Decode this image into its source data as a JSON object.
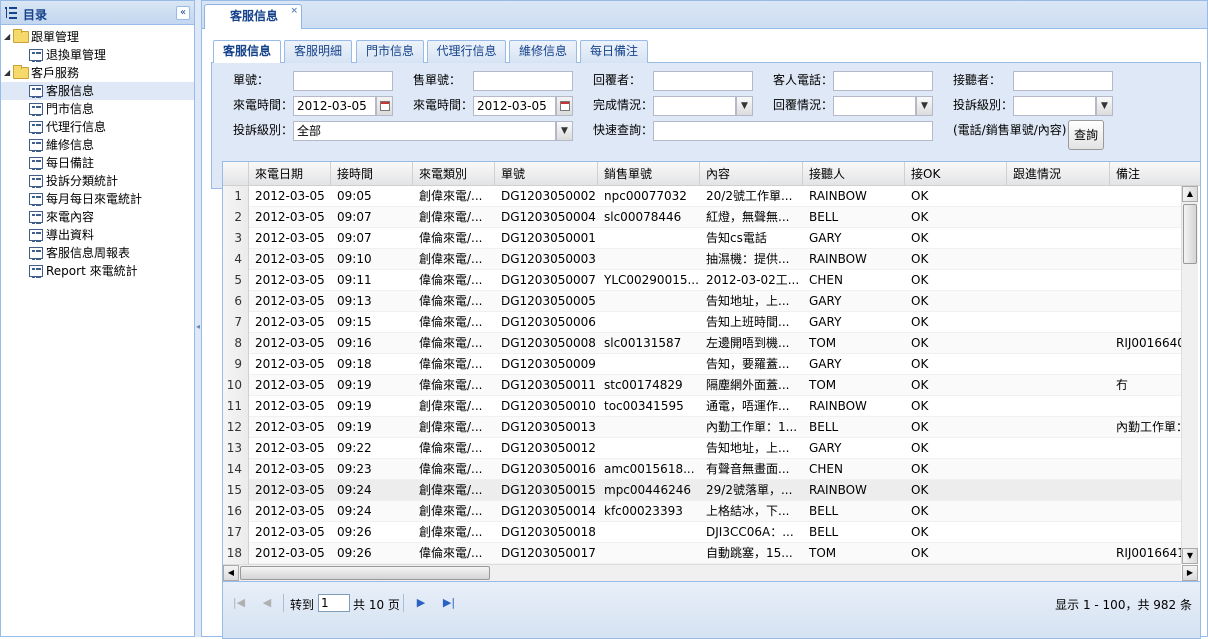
{
  "tree": {
    "title": "目录",
    "collapse_symbol": "«",
    "nodes": [
      {
        "label": "跟單管理",
        "type": "folder",
        "level": 0
      },
      {
        "label": "退換單管理",
        "type": "leaf",
        "level": 1
      },
      {
        "label": "客戶服務",
        "type": "folder",
        "level": 0
      },
      {
        "label": "客服信息",
        "type": "leaf",
        "level": 1,
        "selected": true
      },
      {
        "label": "門市信息",
        "type": "leaf",
        "level": 1
      },
      {
        "label": "代理行信息",
        "type": "leaf",
        "level": 1
      },
      {
        "label": "維修信息",
        "type": "leaf",
        "level": 1
      },
      {
        "label": "每日備註",
        "type": "leaf",
        "level": 1
      },
      {
        "label": "投訴分類統計",
        "type": "leaf",
        "level": 1
      },
      {
        "label": "每月每日來電統計",
        "type": "leaf",
        "level": 1
      },
      {
        "label": "來電內容",
        "type": "leaf",
        "level": 1
      },
      {
        "label": "導出資料",
        "type": "leaf",
        "level": 1
      },
      {
        "label": "客服信息周報表",
        "type": "leaf",
        "level": 1
      },
      {
        "label": "Report 來電統計",
        "type": "leaf",
        "level": 1
      }
    ]
  },
  "outer_tab": {
    "label": "客服信息",
    "close": "×"
  },
  "inner_tabs": [
    "客服信息",
    "客服明細",
    "門市信息",
    "代理行信息",
    "維修信息",
    "每日備注"
  ],
  "form": {
    "order_no_label": "單號：",
    "sales_no_label": "售單號：",
    "reply_by_label": "回覆者：",
    "guest_phone_label": "客人電話：",
    "receiver_label": "接聽者：",
    "call_time_from_label": "來電時間：",
    "call_time_from_value": "2012-03-05",
    "call_time_to_label": "來電時間：",
    "call_time_to_value": "2012-03-05",
    "completion_label": "完成情況：",
    "reply_status_label": "回覆情況：",
    "complaint_level_label": "投訴級別：",
    "complaint_level2_label": "投訴級別：",
    "complaint_level2_value": "全部",
    "quick_search_label": "快速查詢：",
    "quick_search_hint": "(電話/銷售單號/內容)",
    "query_button": "查詢",
    "combo_arrow": "▼"
  },
  "grid": {
    "columns": [
      "來電日期",
      "接時間",
      "來電類別",
      "單號",
      "銷售單號",
      "內容",
      "接聽人",
      "接OK",
      "跟進情況",
      "備注"
    ],
    "rows": [
      {
        "n": "1",
        "date": "2012-03-05",
        "time": "09:05",
        "type": "創偉來電/...",
        "order": "DG1203050002",
        "sales": "npc00077032",
        "content": "20/2號工作單...",
        "receiver": "RAINBOW",
        "ok": "OK",
        "follow": "",
        "note": ""
      },
      {
        "n": "2",
        "date": "2012-03-05",
        "time": "09:07",
        "type": "創偉來電/...",
        "order": "DG1203050004",
        "sales": "slc00078446",
        "content": "紅燈，無聲無...",
        "receiver": "BELL",
        "ok": "OK",
        "follow": "",
        "note": ""
      },
      {
        "n": "3",
        "date": "2012-03-05",
        "time": "09:07",
        "type": "偉倫來電/...",
        "order": "DG1203050001",
        "sales": "",
        "content": "告知cs電話",
        "receiver": "GARY",
        "ok": "OK",
        "follow": "",
        "note": ""
      },
      {
        "n": "4",
        "date": "2012-03-05",
        "time": "09:10",
        "type": "創偉來電/...",
        "order": "DG1203050003",
        "sales": "",
        "content": "抽濕機：提供...",
        "receiver": "RAINBOW",
        "ok": "OK",
        "follow": "",
        "note": ""
      },
      {
        "n": "5",
        "date": "2012-03-05",
        "time": "09:11",
        "type": "偉倫來電/...",
        "order": "DG1203050007",
        "sales": "YLC00290015...",
        "content": "2012-03-02工...",
        "receiver": "CHEN",
        "ok": "OK",
        "follow": "",
        "note": ""
      },
      {
        "n": "6",
        "date": "2012-03-05",
        "time": "09:13",
        "type": "偉倫來電/...",
        "order": "DG1203050005",
        "sales": "",
        "content": "告知地址，上...",
        "receiver": "GARY",
        "ok": "OK",
        "follow": "",
        "note": ""
      },
      {
        "n": "7",
        "date": "2012-03-05",
        "time": "09:15",
        "type": "偉倫來電/...",
        "order": "DG1203050006",
        "sales": "",
        "content": "告知上班時間...",
        "receiver": "GARY",
        "ok": "OK",
        "follow": "",
        "note": ""
      },
      {
        "n": "8",
        "date": "2012-03-05",
        "time": "09:16",
        "type": "偉倫來電/...",
        "order": "DG1203050008",
        "sales": "slc00131587",
        "content": "左邊開唔到機...",
        "receiver": "TOM",
        "ok": "OK",
        "follow": "",
        "note": "RIJ0016640"
      },
      {
        "n": "9",
        "date": "2012-03-05",
        "time": "09:18",
        "type": "偉倫來電/...",
        "order": "DG1203050009",
        "sales": "",
        "content": "告知，要羅蓋...",
        "receiver": "GARY",
        "ok": "OK",
        "follow": "",
        "note": ""
      },
      {
        "n": "10",
        "date": "2012-03-05",
        "time": "09:19",
        "type": "偉倫來電/...",
        "order": "DG1203050011",
        "sales": "stc00174829",
        "content": "隔塵網外面蓋...",
        "receiver": "TOM",
        "ok": "OK",
        "follow": "",
        "note": "冇"
      },
      {
        "n": "11",
        "date": "2012-03-05",
        "time": "09:19",
        "type": "創偉來電/...",
        "order": "DG1203050010",
        "sales": "toc00341595",
        "content": "通電，唔運作...",
        "receiver": "RAINBOW",
        "ok": "OK",
        "follow": "",
        "note": ""
      },
      {
        "n": "12",
        "date": "2012-03-05",
        "time": "09:19",
        "type": "創偉來電/...",
        "order": "DG1203050013",
        "sales": "",
        "content": "內勤工作單：1...",
        "receiver": "BELL",
        "ok": "OK",
        "follow": "",
        "note": "內勤工作單："
      },
      {
        "n": "13",
        "date": "2012-03-05",
        "time": "09:22",
        "type": "偉倫來電/...",
        "order": "DG1203050012",
        "sales": "",
        "content": "告知地址，上...",
        "receiver": "GARY",
        "ok": "OK",
        "follow": "",
        "note": ""
      },
      {
        "n": "14",
        "date": "2012-03-05",
        "time": "09:23",
        "type": "偉倫來電/...",
        "order": "DG1203050016",
        "sales": "amc0015618...",
        "content": "有聲音無畫面...",
        "receiver": "CHEN",
        "ok": "OK",
        "follow": "",
        "note": ""
      },
      {
        "n": "15",
        "date": "2012-03-05",
        "time": "09:24",
        "type": "創偉來電/...",
        "order": "DG1203050015",
        "sales": "mpc00446246",
        "content": "29/2號落單，...",
        "receiver": "RAINBOW",
        "ok": "OK",
        "follow": "",
        "note": ""
      },
      {
        "n": "16",
        "date": "2012-03-05",
        "time": "09:24",
        "type": "創偉來電/...",
        "order": "DG1203050014",
        "sales": "kfc00023393",
        "content": "上格結冰，下...",
        "receiver": "BELL",
        "ok": "OK",
        "follow": "",
        "note": ""
      },
      {
        "n": "17",
        "date": "2012-03-05",
        "time": "09:26",
        "type": "創偉來電/...",
        "order": "DG1203050018",
        "sales": "",
        "content": "DJI3CC06A：...",
        "receiver": "BELL",
        "ok": "OK",
        "follow": "",
        "note": ""
      },
      {
        "n": "18",
        "date": "2012-03-05",
        "time": "09:26",
        "type": "偉倫來電/...",
        "order": "DG1203050017",
        "sales": "",
        "content": "自動跳塞，15...",
        "receiver": "TOM",
        "ok": "OK",
        "follow": "",
        "note": "RIJ0016641"
      }
    ]
  },
  "pager": {
    "goto_label": "转到",
    "page_value": "1",
    "total_pages_label": "共 10 页",
    "summary": "显示 1 - 100，共 982 条"
  }
}
